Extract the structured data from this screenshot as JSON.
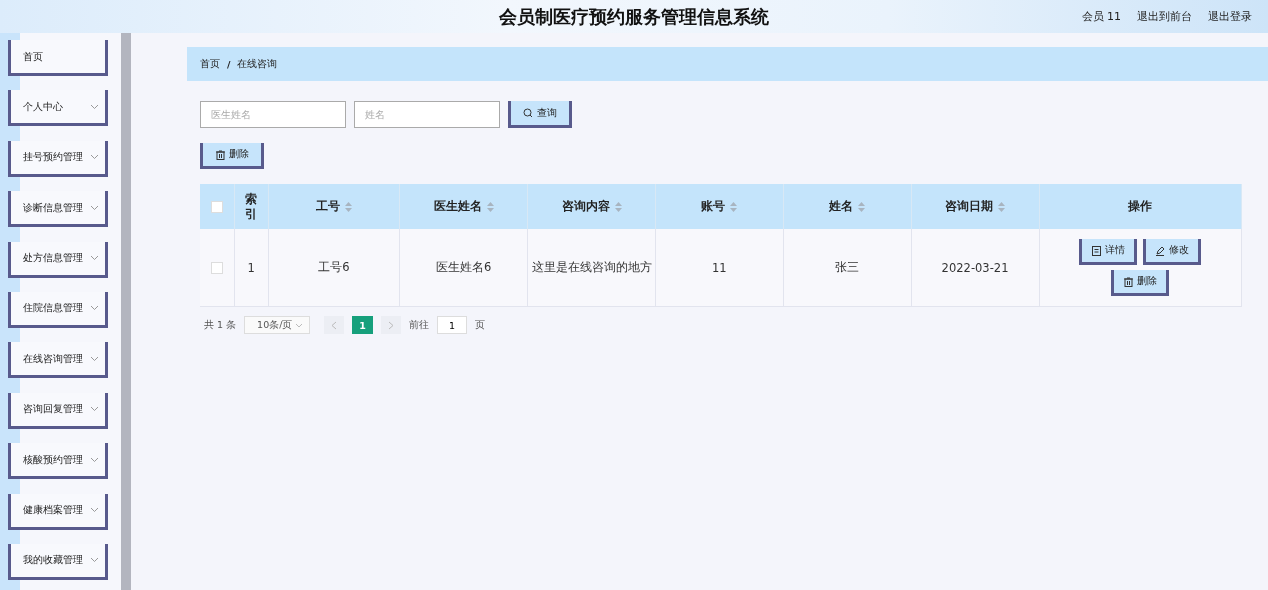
{
  "header": {
    "title": "会员制医疗预约服务管理信息系统",
    "user": "会员 11",
    "links": [
      "退出到前台",
      "退出登录"
    ]
  },
  "sidebar": {
    "items": [
      {
        "label": "首页",
        "kind": "link"
      },
      {
        "label": "个人中心",
        "kind": "menu"
      },
      {
        "label": "挂号预约管理",
        "kind": "menu"
      },
      {
        "label": "诊断信息管理",
        "kind": "menu"
      },
      {
        "label": "处方信息管理",
        "kind": "menu"
      },
      {
        "label": "住院信息管理",
        "kind": "menu"
      },
      {
        "label": "在线咨询管理",
        "kind": "menu"
      },
      {
        "label": "咨询回复管理",
        "kind": "menu"
      },
      {
        "label": "核酸预约管理",
        "kind": "menu"
      },
      {
        "label": "健康档案管理",
        "kind": "menu"
      },
      {
        "label": "我的收藏管理",
        "kind": "menu"
      }
    ]
  },
  "breadcrumb": {
    "items": [
      "首页",
      "在线咨询"
    ],
    "separator": "/"
  },
  "search": {
    "fields": [
      {
        "placeholder": "医生姓名"
      },
      {
        "placeholder": "姓名"
      }
    ],
    "button": "查询"
  },
  "delete_button": "删除",
  "table": {
    "select_all_checked": false,
    "columns": [
      {
        "label": "索引",
        "sortable": false
      },
      {
        "label": "工号",
        "sortable": true
      },
      {
        "label": "医生姓名",
        "sortable": true
      },
      {
        "label": "咨询内容",
        "sortable": true
      },
      {
        "label": "账号",
        "sortable": true
      },
      {
        "label": "姓名",
        "sortable": true
      },
      {
        "label": "咨询日期",
        "sortable": true
      },
      {
        "label": "操作",
        "sortable": false
      }
    ],
    "rows": [
      {
        "checked": false,
        "cells": [
          "1",
          "工号6",
          "医生姓名6",
          "这里是在线咨询的地方",
          "11",
          "张三",
          "2022-03-21"
        ],
        "actions": [
          "详情",
          "修改",
          "删除"
        ]
      }
    ]
  },
  "pagination": {
    "total": "共 1 条",
    "page_size": "10条/页",
    "pages": [
      {
        "label": "1",
        "selected": true
      }
    ],
    "goto_label": "前往",
    "goto_value": "1",
    "goto_suffix": "页"
  }
}
